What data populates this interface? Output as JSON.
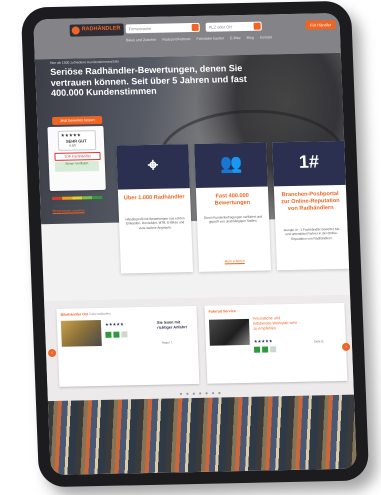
{
  "header": {
    "logo_text": "RADHÄNDLER",
    "search_name_placeholder": "Firmenname",
    "search_location_placeholder": "PLZ oder Ort",
    "cta_label": "Für Händler",
    "nav": [
      "Bikes und Zubehör",
      "Radsport/Fahrrad",
      "Fahrräder kaufen",
      "E-Bike",
      "Blog",
      "Kontakt"
    ]
  },
  "hero": {
    "breadcrumb": "Hier ab 1500 zufriedene Kundenstimmen/Jahr",
    "title": "Seriöse Radhändler-Bewertungen, denen Sie vertrauen können. Seit über 5 Jahren und fast 400.000 Kundenstimmen",
    "button": "Jetzt bewerten lassen"
  },
  "rating_card": {
    "stars": "★★★★★",
    "grade": "SEHR GUT",
    "score": "4,8/5",
    "badge_label": "TOP Fachhändler",
    "green_label": "Sicher Verifiziert",
    "scale_label": "Qualität des Händlers",
    "scale_link": "Bewertungen ansehen",
    "scale_colors": [
      "#d33c2c",
      "#f0a020",
      "#e8d22a",
      "#7cc04a",
      "#2e9a3e"
    ]
  },
  "features": [
    {
      "icon": "map-pin-icon",
      "icon_glyph": "⌖",
      "title": "Über 1.000 Radhändler",
      "text": "Händlerprofil mit Bewertungen aus echten Einkäufen. Rennräder, MTB, E-Bikes und viele weitere Angebote.",
      "link": ""
    },
    {
      "icon": "users-icon",
      "icon_glyph": "👥",
      "title": "Fast 400.000 Bewertungen",
      "text": "Durch Kundenbefragungen verifiziert und geprüft von unabhängigen Stellen.",
      "link": "Mehr erfahren"
    },
    {
      "icon": "number-one-icon",
      "icon_glyph": "1#",
      "title": "Branchen-Posbportal zur Online-Reputation von Radhändlern",
      "text": "Google 4+, 1 Fachhändler bewertet Sie und unterstützt Partner in der Online-Reputation von Radhändlern.",
      "link": ""
    }
  ],
  "reviews": [
    {
      "dealer": "Bikehändler Ost",
      "subtitle": "Fahrradladen",
      "stars": "★★★★★",
      "quote": "Sie lesen mit richtiger Anfahrt",
      "meta": "Radel T."
    },
    {
      "dealer": "Fahrrad Service",
      "subtitle": "",
      "stars": "★★★★★",
      "quote": "Freundliche und hilfsbereite Werkstatt sehr zu empfehlen",
      "meta": "Seite B."
    }
  ],
  "carousel": {
    "dots": "● ● ● ● ● ● ●",
    "prev": "‹",
    "next": "›"
  }
}
